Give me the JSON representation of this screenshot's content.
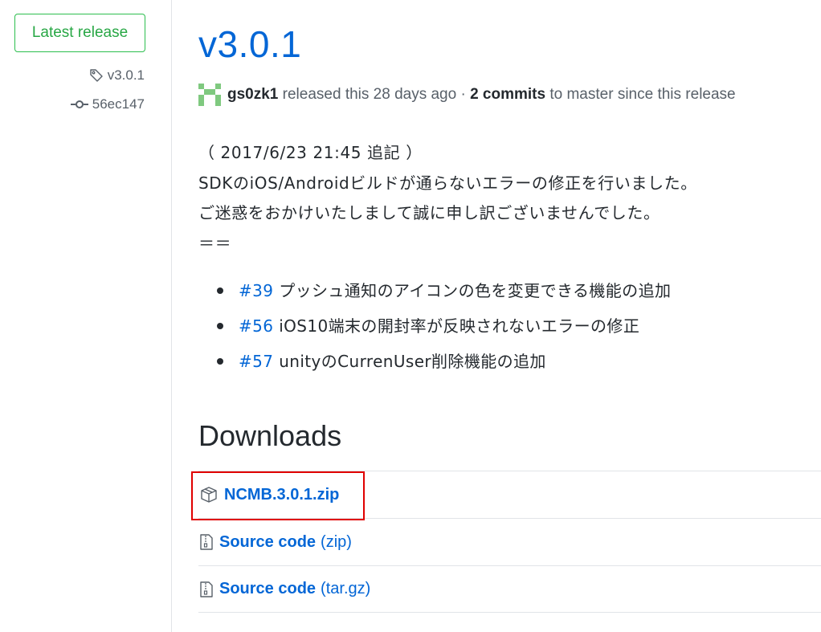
{
  "sidebar": {
    "latest_label": "Latest release",
    "tag": "v3.0.1",
    "commit": "56ec147",
    "tag_icon": "tag-icon",
    "commit_icon": "git-commit-icon"
  },
  "release": {
    "title": "v3.0.1",
    "author": "gs0zk1",
    "released_text": "released this 28 days ago ·",
    "commits_text": "2 commits",
    "since_text": "to master since this release"
  },
  "body": {
    "lines": [
      "（ 2017/6/23 21:45 追記 ）",
      "SDKのiOS/Androidビルドが通らないエラーの修正を行いました。",
      "ご迷惑をおかけいたしまして誠に申し訳ございませんでした。",
      "＝＝"
    ],
    "changes": [
      {
        "issue": "#39",
        "text": "プッシュ通知のアイコンの色を変更できる機能の追加"
      },
      {
        "issue": "#56",
        "text": "iOS10端末の開封率が反映されないエラーの修正"
      },
      {
        "issue": "#57",
        "text": "unityのCurrenUser削除機能の追加"
      }
    ]
  },
  "downloads": {
    "title": "Downloads",
    "items": [
      {
        "name": "NCMB.3.0.1.zip",
        "type": "",
        "icon": "package-icon"
      },
      {
        "name": "Source code",
        "type": "(zip)",
        "icon": "file-zip-icon"
      },
      {
        "name": "Source code",
        "type": "(tar.gz)",
        "icon": "file-zip-icon"
      }
    ]
  },
  "colors": {
    "accent": "#0366d6",
    "latest_green": "#28a745",
    "highlight_red": "#e00000"
  }
}
